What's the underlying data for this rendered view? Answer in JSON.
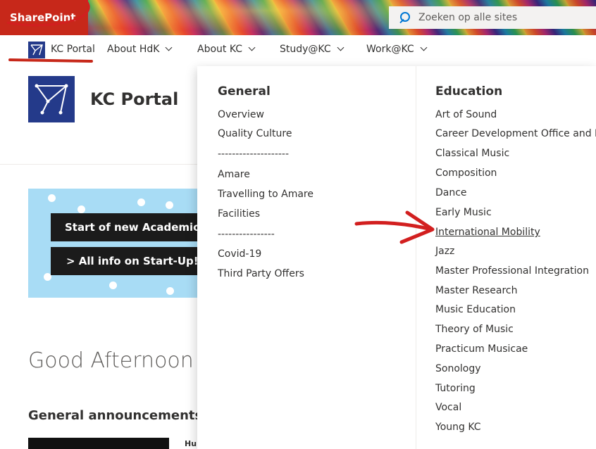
{
  "suitebar": {
    "brand": "SharePoint",
    "search_placeholder": "Zoeken op alle sites"
  },
  "topnav": {
    "items": [
      {
        "label": "KC Portal",
        "has_menu": false
      },
      {
        "label": "About HdK",
        "has_menu": true
      },
      {
        "label": "About KC",
        "has_menu": true
      },
      {
        "label": "Study@KC",
        "has_menu": true
      },
      {
        "label": "Work@KC",
        "has_menu": true
      }
    ]
  },
  "site": {
    "title": "KC Portal"
  },
  "banner": {
    "line1": "Start of new Academic",
    "line2": "> All info on Start-Up! W"
  },
  "main": {
    "greeting": "Good Afternoon El",
    "announcements_heading": "General announcements",
    "news_snippet": "Hu"
  },
  "megamenu": {
    "general": {
      "heading": "General",
      "links": [
        "Overview",
        "Quality Culture",
        "--------------------",
        "Amare",
        "Travelling to Amare",
        "Facilities",
        "----------------",
        "Covid-19",
        "Third Party Offers"
      ]
    },
    "education": {
      "heading": "Education",
      "links": [
        "Art of Sound",
        "Career Development Office and Pod",
        "Classical Music",
        "Composition",
        "Dance",
        "Early Music",
        "International Mobility",
        "Jazz",
        "Master Professional Integration",
        "Master Research",
        "Music Education",
        "Theory of Music",
        "Practicum Musicae",
        "Sonology",
        "Tutoring",
        "Vocal",
        "Young KC"
      ],
      "hovered": "International Mobility"
    }
  },
  "colors": {
    "brand_red": "#c7281a",
    "site_logo_blue": "#243a8a",
    "banner_blue": "#a8dcf5",
    "search_accent": "#0078d4"
  }
}
